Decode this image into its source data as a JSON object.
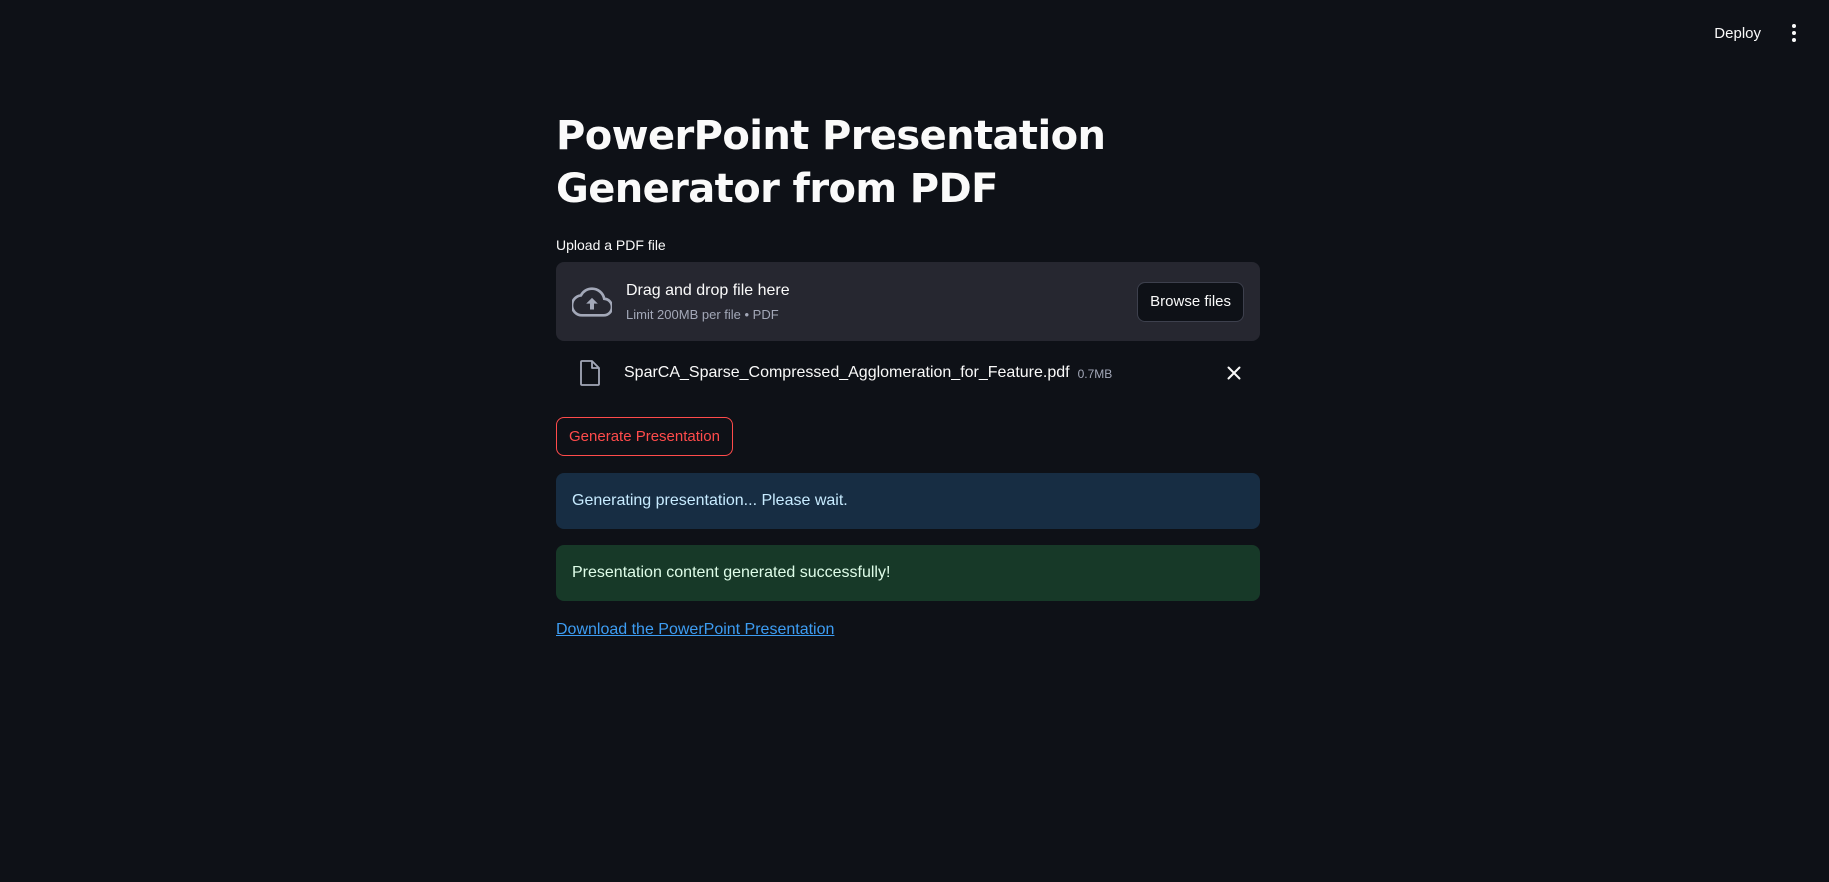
{
  "header": {
    "deploy_label": "Deploy",
    "menu_icon": "more-vertical-icon"
  },
  "page": {
    "title": "PowerPoint Presentation Generator from PDF"
  },
  "uploader": {
    "label": "Upload a PDF file",
    "dropzone_title": "Drag and drop file here",
    "dropzone_subtitle": "Limit 200MB per file • PDF",
    "browse_label": "Browse files",
    "icon": "cloud-upload-icon"
  },
  "uploaded_file": {
    "name": "SparCA_Sparse_Compressed_Agglomeration_for_Feature.pdf",
    "size": "0.7MB",
    "icon": "file-icon"
  },
  "actions": {
    "generate_label": "Generate Presentation"
  },
  "status": {
    "info_message": "Generating presentation... Please wait.",
    "success_message": "Presentation content generated successfully!"
  },
  "download": {
    "link_label": "Download the PowerPoint Presentation"
  },
  "colors": {
    "background": "#0e1117",
    "accent": "#ff4b4b",
    "info_bg": "#172d43",
    "success_bg": "#173928",
    "link": "#3d9df3"
  }
}
